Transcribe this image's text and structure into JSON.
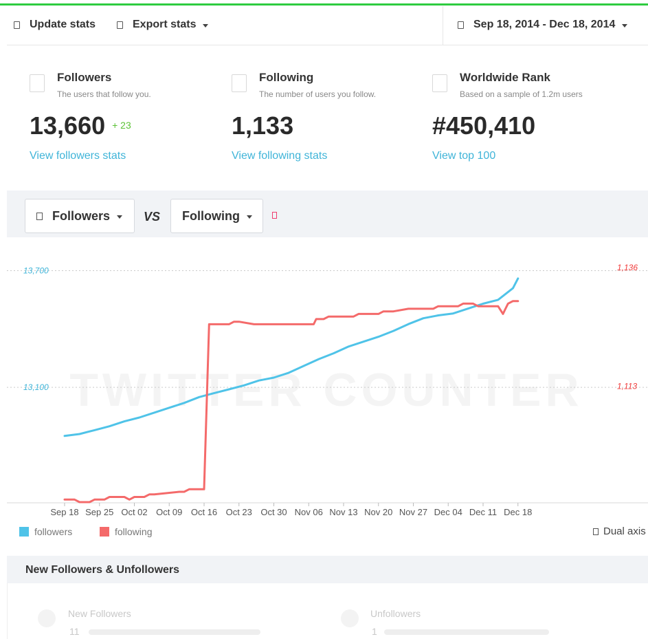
{
  "toolbar": {
    "update_label": "Update stats",
    "export_label": "Export stats",
    "date_range": "Sep 18, 2014 - Dec 18, 2014"
  },
  "stats": [
    {
      "title": "Followers",
      "subtitle": "The users that follow you.",
      "value": "13,660",
      "delta": "+ 23",
      "link": "View followers stats"
    },
    {
      "title": "Following",
      "subtitle": "The number of users you follow.",
      "value": "1,133",
      "link": "View following stats"
    },
    {
      "title": "Worldwide Rank",
      "subtitle": "Based on a sample of 1.2m users",
      "value": "#450,410",
      "link": "View top 100"
    }
  ],
  "compare": {
    "left_label": "Followers",
    "vs_label": "VS",
    "right_label": "Following"
  },
  "colors": {
    "followers": "#4fc3e8",
    "following": "#f46a6a",
    "link": "#3fb4d8",
    "delta": "#5bc236"
  },
  "chart_data": {
    "type": "line",
    "watermark": "TWITTER COUNTER",
    "x_ticks": [
      "Sep 18",
      "Sep 25",
      "Oct 02",
      "Oct 09",
      "Oct 16",
      "Oct 23",
      "Oct 30",
      "Nov 06",
      "Nov 13",
      "Nov 20",
      "Nov 27",
      "Dec 04",
      "Dec 11",
      "Dec 18"
    ],
    "left_axis": {
      "ticks": [
        "13,700",
        "13,100"
      ],
      "values": [
        13700,
        13100
      ],
      "range": [
        12510,
        13790
      ]
    },
    "right_axis": {
      "ticks": [
        "1,136",
        "1,113"
      ],
      "values": [
        1136,
        1113
      ],
      "range": [
        1090.5,
        1138.8
      ]
    },
    "legend_position": "bottom-left",
    "series": [
      {
        "name": "followers",
        "axis": "left",
        "day": [
          0,
          3,
          6,
          9,
          12,
          15,
          18,
          21,
          24,
          27,
          30,
          33,
          36,
          39,
          42,
          45,
          48,
          51,
          54,
          57,
          60,
          63,
          66,
          69,
          72,
          75,
          78,
          81,
          84,
          87,
          90,
          91
        ],
        "values": [
          12850,
          12860,
          12880,
          12900,
          12925,
          12945,
          12970,
          12995,
          13020,
          13050,
          13070,
          13090,
          13110,
          13135,
          13150,
          13175,
          13210,
          13245,
          13275,
          13310,
          13335,
          13360,
          13390,
          13425,
          13455,
          13470,
          13480,
          13505,
          13530,
          13550,
          13610,
          13660
        ]
      },
      {
        "name": "following",
        "axis": "right",
        "day": [
          0,
          2,
          3,
          5,
          6,
          8,
          9,
          12,
          13,
          14,
          16,
          17,
          18,
          23,
          24,
          25,
          26,
          28,
          29,
          33,
          34,
          35,
          38,
          40,
          41,
          44,
          45,
          48,
          50,
          50.5,
          52,
          53,
          58,
          59,
          63,
          64,
          66,
          69,
          70,
          74,
          75,
          79,
          80,
          82,
          83,
          87,
          88,
          88.5,
          89,
          90,
          91
        ],
        "values": [
          1091,
          1091,
          1090.5,
          1090.5,
          1091,
          1091,
          1091.5,
          1091.5,
          1091,
          1091.5,
          1091.5,
          1092,
          1092,
          1092.5,
          1092.5,
          1093,
          1093,
          1093,
          1125,
          1125,
          1125.5,
          1125.5,
          1125,
          1125,
          1125,
          1125,
          1125,
          1125,
          1125,
          1126,
          1126,
          1126.5,
          1126.5,
          1127,
          1127,
          1127.5,
          1127.5,
          1128,
          1128,
          1128,
          1128.5,
          1128.5,
          1129,
          1129,
          1128.5,
          1128.5,
          1127,
          1128,
          1129,
          1129.5,
          1129.5
        ]
      }
    ]
  },
  "legend": {
    "followers": "followers",
    "following": "following",
    "dual_axis": "Dual axis"
  },
  "section": {
    "title": "New Followers & Unfollowers",
    "new_label": "New Followers",
    "new_value": "11",
    "unfollow_label": "Unfollowers",
    "unfollow_value": "1"
  }
}
